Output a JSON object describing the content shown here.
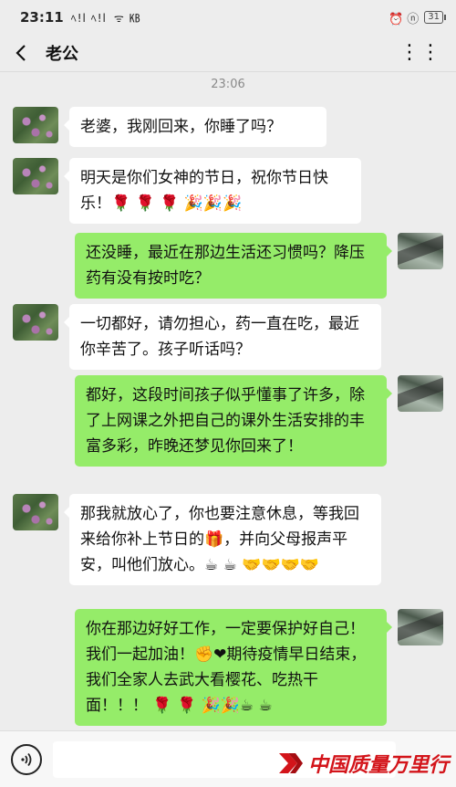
{
  "status_bar": {
    "time": "23:11",
    "signal": "ﾍ!l ﾍ!l",
    "network": "ᯤ ㎅",
    "icons": "⏰ ⓝ",
    "battery": "31"
  },
  "header": {
    "title": "老公"
  },
  "timestamp": "23:06",
  "messages": [
    {
      "side": "left",
      "text": "老婆，我刚回来，你睡了吗？"
    },
    {
      "side": "left",
      "text": "明天是你们女神的节日，祝你节日快乐！🌹 🌹 🌹 🎉🎉🎉"
    },
    {
      "side": "right",
      "text": "还没睡，最近在那边生活还习惯吗？降压药有没有按时吃？"
    },
    {
      "side": "left",
      "text": "一切都好，请勿担心，药一直在吃，最近你辛苦了。孩子听话吗？"
    },
    {
      "side": "right",
      "text": "都好，这段时间孩子似乎懂事了许多，除了上网课之外把自己的课外生活安排的丰富多彩，昨晚还梦见你回来了！"
    },
    {
      "side": "left",
      "text": "那我就放心了，你也要注意休息，等我回来给你补上节日的🎁，并向父母报声平安，叫他们放心。☕ ☕ 🤝🤝🤝🤝"
    },
    {
      "side": "right",
      "text": "你在那边好好工作，一定要保护好自己！我们一起加油！✊❤期待疫情早日结束，我们全家人去武大看樱花、吃热干面！！！ 🌹 🌹 🎉🎉☕ ☕"
    }
  ],
  "watermark": {
    "text": "中国质量万里行"
  },
  "colors": {
    "background": "#ededed",
    "sent_bubble": "#95ec69",
    "received_bubble": "#ffffff",
    "watermark": "#d3141a"
  }
}
